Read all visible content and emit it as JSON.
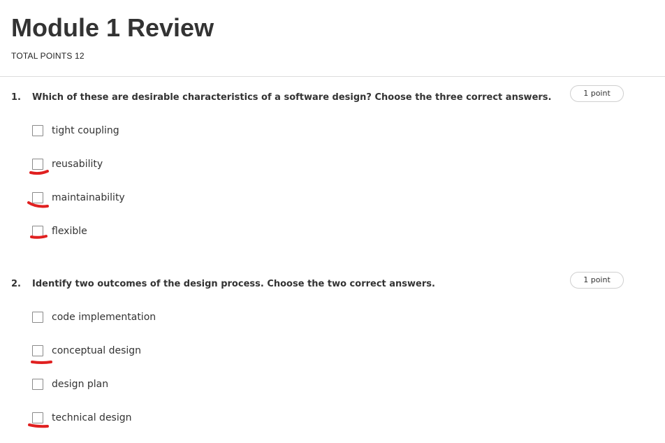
{
  "page": {
    "title": "Module 1 Review",
    "total_points": "TOTAL POINTS 12"
  },
  "questions": [
    {
      "number": "1.",
      "text": "Which of these are desirable characteristics of a software design? Choose the three correct answers.",
      "points": "1 point",
      "options": [
        {
          "label": "tight coupling",
          "marked": false
        },
        {
          "label": "reusability",
          "marked": true
        },
        {
          "label": "maintainability",
          "marked": true
        },
        {
          "label": "flexible",
          "marked": true
        }
      ]
    },
    {
      "number": "2.",
      "text": "Identify two outcomes of the design process. Choose the two correct answers.",
      "points": "1 point",
      "options": [
        {
          "label": "code implementation",
          "marked": false
        },
        {
          "label": "conceptual design",
          "marked": true
        },
        {
          "label": "design plan",
          "marked": false
        },
        {
          "label": "technical design",
          "marked": true
        }
      ]
    }
  ],
  "colors": {
    "annotation_mark": "#e02020",
    "text": "#333333",
    "checkbox_border": "#8a8a8a"
  }
}
